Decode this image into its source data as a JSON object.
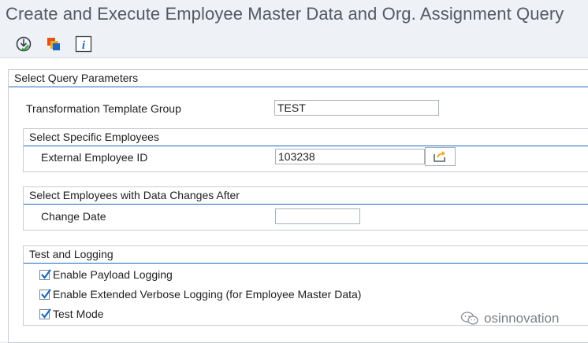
{
  "window": {
    "title": "Create and Execute Employee Master Data and Org. Assignment Query"
  },
  "toolbar": {
    "buttons": [
      {
        "icon": "execute-icon"
      },
      {
        "icon": "variants-icon"
      },
      {
        "icon": "info-icon"
      }
    ]
  },
  "query_params": {
    "title": "Select Query Parameters",
    "template_group_label": "Transformation Template Group",
    "template_group_value": "TEST"
  },
  "specific_employees": {
    "title": "Select Specific Employees",
    "employee_id_label": "External Employee ID",
    "employee_id_value": "103238"
  },
  "data_changes": {
    "title": "Select Employees with Data Changes After",
    "change_date_label": "Change Date",
    "change_date_value": ""
  },
  "test_logging": {
    "title": "Test and Logging",
    "options": [
      {
        "label": "Enable Payload Logging",
        "checked": true
      },
      {
        "label": "Enable Extended Verbose Logging (for Employee Master Data)",
        "checked": true
      },
      {
        "label": "Test Mode",
        "checked": true
      }
    ]
  },
  "watermark": {
    "text": "osinnovation"
  },
  "colors": {
    "accent": "#1a68c1",
    "background": "#eef2f6"
  }
}
